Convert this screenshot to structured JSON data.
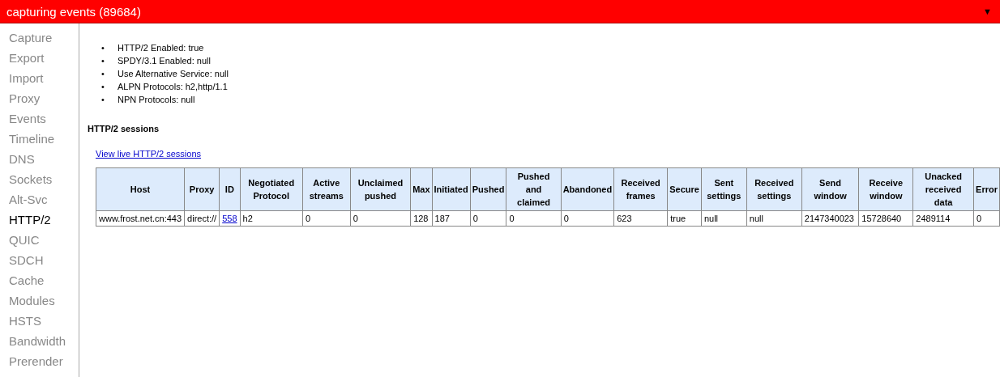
{
  "title_bar": {
    "title": "capturing events (89684)",
    "menu_toggle": "▼"
  },
  "sidebar": {
    "items": [
      {
        "label": "Capture",
        "selected": false
      },
      {
        "label": "Export",
        "selected": false
      },
      {
        "label": "Import",
        "selected": false
      },
      {
        "label": "Proxy",
        "selected": false
      },
      {
        "label": "Events",
        "selected": false
      },
      {
        "label": "Timeline",
        "selected": false
      },
      {
        "label": "DNS",
        "selected": false
      },
      {
        "label": "Sockets",
        "selected": false
      },
      {
        "label": "Alt-Svc",
        "selected": false
      },
      {
        "label": "HTTP/2",
        "selected": true
      },
      {
        "label": "QUIC",
        "selected": false
      },
      {
        "label": "SDCH",
        "selected": false
      },
      {
        "label": "Cache",
        "selected": false
      },
      {
        "label": "Modules",
        "selected": false
      },
      {
        "label": "HSTS",
        "selected": false
      },
      {
        "label": "Bandwidth",
        "selected": false
      },
      {
        "label": "Prerender",
        "selected": false
      }
    ]
  },
  "status_list": [
    {
      "bullet": "•",
      "text": "HTTP/2 Enabled: true"
    },
    {
      "bullet": "•",
      "text": "SPDY/3.1 Enabled: null"
    },
    {
      "bullet": "•",
      "text": "Use Alternative Service: null"
    },
    {
      "bullet": "•",
      "text": "ALPN Protocols: h2,http/1.1"
    },
    {
      "bullet": "•",
      "text": "NPN Protocols: null"
    }
  ],
  "sessions_heading": "HTTP/2 sessions",
  "live_link": "View live HTTP/2 sessions",
  "table": {
    "columns": [
      "Host",
      "Proxy",
      "ID",
      "Negotiated Protocol",
      "Active streams",
      "Unclaimed pushed",
      "Max",
      "Initiated",
      "Pushed",
      "Pushed and claimed",
      "Abandoned",
      "Received frames",
      "Secure",
      "Sent settings",
      "Received settings",
      "Send window",
      "Receive window",
      "Unacked received data",
      "Error"
    ],
    "rows": [
      {
        "cells": [
          {
            "kind": "text",
            "text": "www.frost.net.cn:443"
          },
          {
            "kind": "text",
            "text": "direct://"
          },
          {
            "kind": "link",
            "text": "558"
          },
          {
            "kind": "text",
            "text": "h2"
          },
          {
            "kind": "text",
            "text": "0"
          },
          {
            "kind": "text",
            "text": "0"
          },
          {
            "kind": "text",
            "text": "128"
          },
          {
            "kind": "text",
            "text": "187"
          },
          {
            "kind": "text",
            "text": "0"
          },
          {
            "kind": "text",
            "text": "0"
          },
          {
            "kind": "text",
            "text": "0"
          },
          {
            "kind": "text",
            "text": "623"
          },
          {
            "kind": "text",
            "text": "true"
          },
          {
            "kind": "text",
            "text": "null"
          },
          {
            "kind": "text",
            "text": "null"
          },
          {
            "kind": "text",
            "text": "2147340023"
          },
          {
            "kind": "text",
            "text": "15728640"
          },
          {
            "kind": "text",
            "text": "2489114"
          },
          {
            "kind": "text",
            "text": "0"
          }
        ]
      }
    ]
  }
}
